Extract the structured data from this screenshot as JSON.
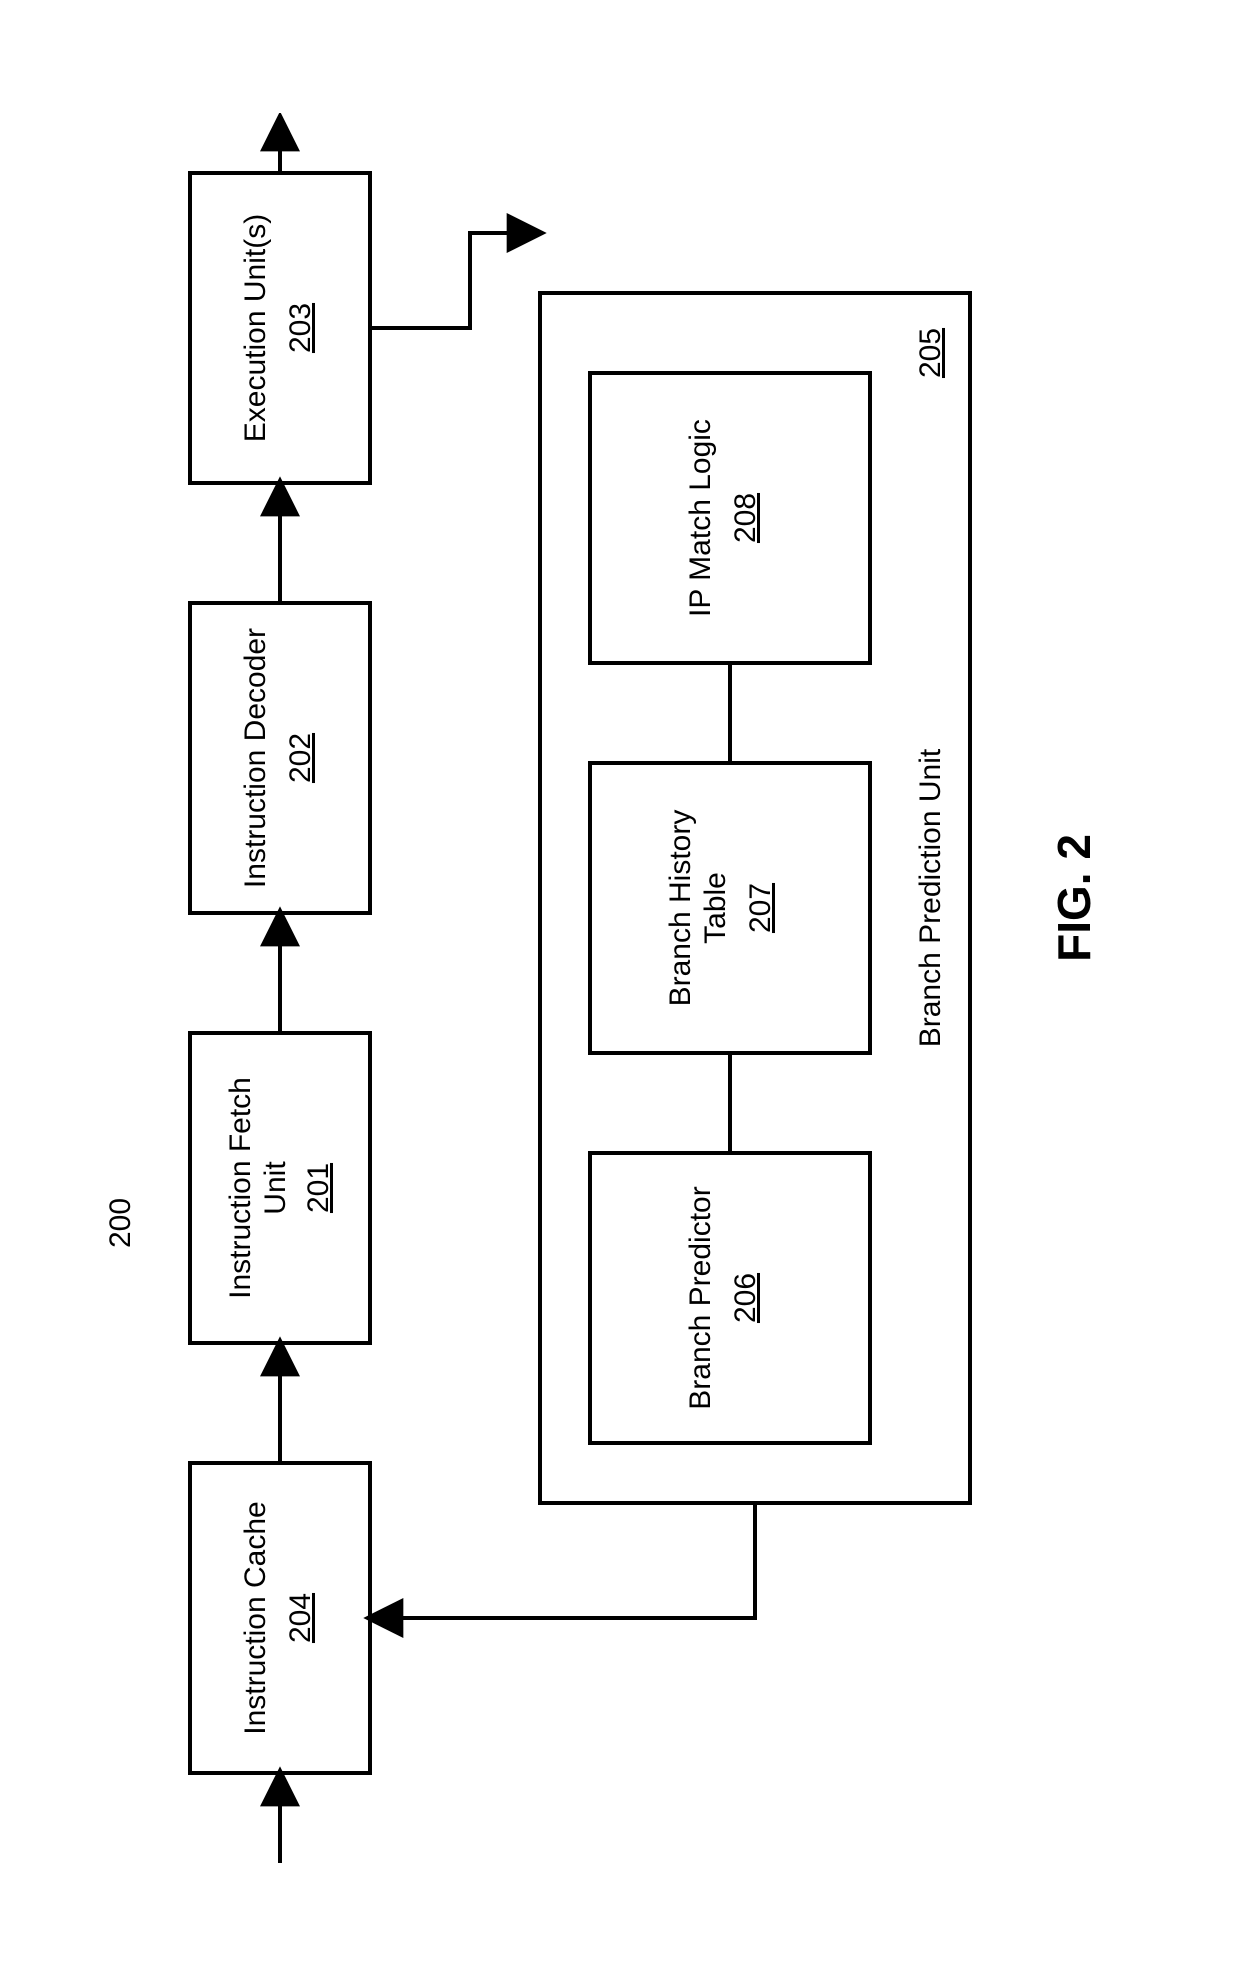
{
  "diagram": {
    "id_label": "200",
    "figure_label": "FIG. 2",
    "bpu_label": "Branch Prediction Unit",
    "bpu_ref": "205",
    "blocks": {
      "icache": {
        "label1": "Instruction Cache",
        "label2": "",
        "ref": "204"
      },
      "ifu": {
        "label1": "Instruction Fetch",
        "label2": "Unit",
        "ref": "201"
      },
      "decoder": {
        "label1": "Instruction Decoder",
        "label2": "",
        "ref": "202"
      },
      "exec": {
        "label1": "Execution Unit(s)",
        "label2": "",
        "ref": "203"
      },
      "bp": {
        "label1": "Branch Predictor",
        "label2": "",
        "ref": "206"
      },
      "bht": {
        "label1": "Branch History",
        "label2": "Table",
        "ref": "207"
      },
      "ipm": {
        "label1": "IP Match Logic",
        "label2": "",
        "ref": "208"
      }
    }
  }
}
